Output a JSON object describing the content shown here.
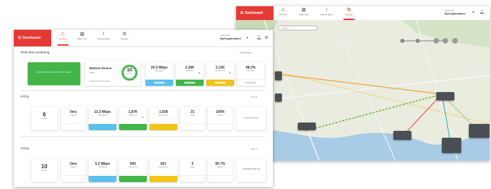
{
  "colors": {
    "brand_red": "#e53935",
    "green": "#43b649",
    "blue": "#5bc0eb",
    "yellow": "#f0c419",
    "map_land": "#e9ecdf",
    "map_sea": "#a8cbe6",
    "link_orange": "#f0a54b",
    "link_green": "#6aaa2a",
    "link_red": "#d84a3a",
    "link_teal": "#2b9fb0"
  },
  "header": {
    "brand": "Dashboard",
    "nav": [
      {
        "label": "Archives",
        "icon": "warning-icon"
      },
      {
        "label": "Table view",
        "icon": "table-icon"
      },
      {
        "label": "Data Analysis",
        "icon": "chart-icon"
      },
      {
        "label": "Topology",
        "icon": "topology-icon"
      }
    ],
    "org_label": "Organization",
    "org_value": "MyOrganization"
  },
  "map_window": {
    "active_nav": 3,
    "search_placeholder": "Search..."
  },
  "dashboard": {
    "active_nav": 0,
    "section_realtime": "Real time monitoring",
    "realtime_link": "All Devices",
    "banner_text": "If all the devices are online, it's green",
    "summary": {
      "title": "Wattnet Device",
      "sub": "online",
      "count": "10",
      "count_label": "devices",
      "footnote": "Total Device (Online/Total)"
    },
    "realtime_metrics": [
      {
        "value": "24.3 Mbps",
        "label": "Throughput",
        "color": "blue",
        "indicator": "up"
      },
      {
        "value": "2,34K",
        "label": "Packets In",
        "color": "green",
        "indicator": "up"
      },
      {
        "value": "2,12K",
        "label": "Packets Out",
        "color": "yellow",
        "indicator": "up"
      },
      {
        "value": "98.3%",
        "label": "Link Rate",
        "color": "",
        "indicator": ""
      }
    ],
    "pit01": {
      "title": "PIT01",
      "link": "more",
      "devices_value": "6",
      "devices_label": "devices",
      "metrics": [
        {
          "value": "0ms",
          "label": "Latency",
          "color": "",
          "indicator": ""
        },
        {
          "value": "12,3 Mbps",
          "label": "Throughput",
          "color": "blue",
          "indicator": ""
        },
        {
          "value": "1,87K",
          "label": "Packets In",
          "color": "green",
          "indicator": "up"
        },
        {
          "value": "1,038",
          "label": "Packets Out",
          "color": "yellow",
          "indicator": ""
        },
        {
          "value": "21",
          "label": "Flags",
          "color": "",
          "indicator": ""
        },
        {
          "value": "100%",
          "label": "Uptime",
          "color": "",
          "indicator": ""
        }
      ],
      "extra_text": "No devices offline"
    },
    "pit02": {
      "title": "PIT02",
      "link": "more",
      "devices_value": "10",
      "devices_label": "devices",
      "metrics": [
        {
          "value": "0ms",
          "label": "Latency",
          "color": "",
          "indicator": ""
        },
        {
          "value": "6,2 Mbps",
          "label": "Throughput",
          "color": "blue",
          "indicator": ""
        },
        {
          "value": "943",
          "label": "Packets In",
          "color": "green",
          "indicator": ""
        },
        {
          "value": "831",
          "label": "Packets Out",
          "color": "yellow",
          "indicator": ""
        },
        {
          "value": "0",
          "label": "Flags",
          "color": "",
          "indicator": ""
        },
        {
          "value": "95.7%",
          "label": "Uptime",
          "color": "",
          "indicator": ""
        }
      ],
      "extra_text": "10/9/2023 15:07:10"
    }
  }
}
